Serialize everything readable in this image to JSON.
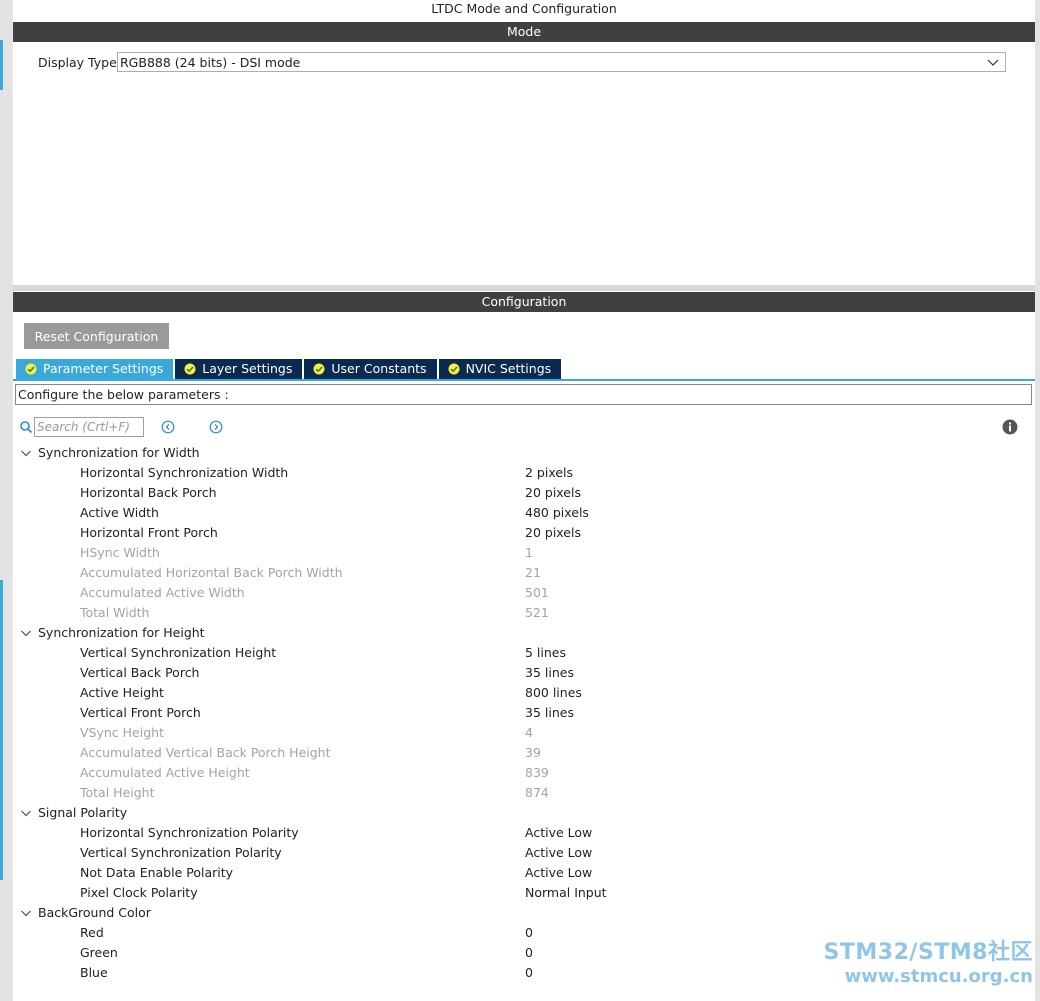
{
  "window_title": "LTDC Mode and Configuration",
  "mode": {
    "header": "Mode",
    "display_type_label": "Display Type",
    "display_type_value": "RGB888 (24 bits) - DSI mode"
  },
  "configuration": {
    "header": "Configuration",
    "reset_button": "Reset Configuration",
    "tabs": [
      {
        "label": "Parameter Settings",
        "active": true
      },
      {
        "label": "Layer Settings",
        "active": false
      },
      {
        "label": "User Constants",
        "active": false
      },
      {
        "label": "NVIC Settings",
        "active": false
      }
    ],
    "description": "Configure the below parameters :",
    "search_placeholder": "Search (Crtl+F)"
  },
  "groups": [
    {
      "name": "Synchronization for Width",
      "params": [
        {
          "name": "Horizontal Synchronization Width",
          "value": "2 pixels",
          "readonly": false
        },
        {
          "name": "Horizontal Back Porch",
          "value": "20 pixels",
          "readonly": false
        },
        {
          "name": "Active Width",
          "value": "480 pixels",
          "readonly": false
        },
        {
          "name": "Horizontal Front Porch",
          "value": "20 pixels",
          "readonly": false
        },
        {
          "name": "HSync Width",
          "value": "1",
          "readonly": true
        },
        {
          "name": "Accumulated Horizontal Back Porch Width",
          "value": "21",
          "readonly": true
        },
        {
          "name": "Accumulated Active Width",
          "value": "501",
          "readonly": true
        },
        {
          "name": "Total Width",
          "value": "521",
          "readonly": true
        }
      ]
    },
    {
      "name": "Synchronization for Height",
      "params": [
        {
          "name": "Vertical Synchronization Height",
          "value": "5 lines",
          "readonly": false
        },
        {
          "name": "Vertical Back Porch",
          "value": "35 lines",
          "readonly": false
        },
        {
          "name": "Active Height",
          "value": "800 lines",
          "readonly": false
        },
        {
          "name": "Vertical Front Porch",
          "value": "35 lines",
          "readonly": false
        },
        {
          "name": "VSync Height",
          "value": "4",
          "readonly": true
        },
        {
          "name": "Accumulated Vertical Back Porch Height",
          "value": "39",
          "readonly": true
        },
        {
          "name": "Accumulated Active Height",
          "value": "839",
          "readonly": true
        },
        {
          "name": "Total Height",
          "value": "874",
          "readonly": true
        }
      ]
    },
    {
      "name": "Signal Polarity",
      "params": [
        {
          "name": "Horizontal Synchronization Polarity",
          "value": "Active Low",
          "readonly": false
        },
        {
          "name": "Vertical Synchronization Polarity",
          "value": "Active Low",
          "readonly": false
        },
        {
          "name": "Not Data Enable Polarity",
          "value": "Active Low",
          "readonly": false
        },
        {
          "name": "Pixel Clock Polarity",
          "value": "Normal Input",
          "readonly": false
        }
      ]
    },
    {
      "name": "BackGround Color",
      "params": [
        {
          "name": "Red",
          "value": "0",
          "readonly": false
        },
        {
          "name": "Green",
          "value": "0",
          "readonly": false
        },
        {
          "name": "Blue",
          "value": "0",
          "readonly": false
        }
      ]
    }
  ],
  "watermark": {
    "line1": "STM32/STM8社区",
    "line2": "www.stmcu.org.cn"
  },
  "colors": {
    "header_bg": "#404040",
    "tab_active": "#39a9dc",
    "tab_inactive": "#0a2a52",
    "readonly_text": "#a3a3a3",
    "reset_button_bg": "#9a9a9a",
    "watermark": "#8fc6e8"
  }
}
